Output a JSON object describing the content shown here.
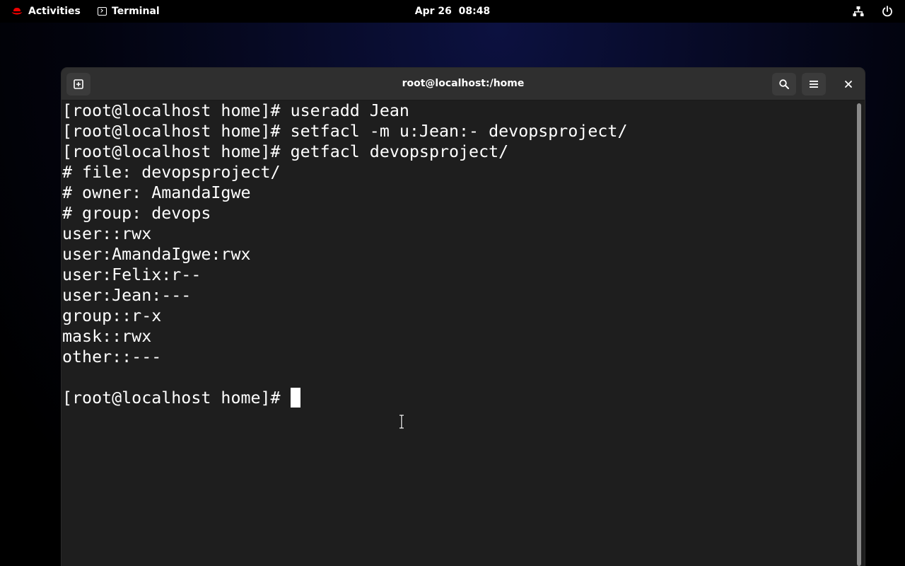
{
  "topbar": {
    "activities_label": "Activities",
    "app_label": "Terminal",
    "clock": "Apr 26  08:48"
  },
  "window": {
    "title": "root@localhost:/home"
  },
  "terminal": {
    "lines": [
      "[root@localhost home]# useradd Jean",
      "[root@localhost home]# setfacl -m u:Jean:- devopsproject/",
      "[root@localhost home]# getfacl devopsproject/",
      "# file: devopsproject/",
      "# owner: AmandaIgwe",
      "# group: devops",
      "user::rwx",
      "user:AmandaIgwe:rwx",
      "user:Felix:r--",
      "user:Jean:---",
      "group::r-x",
      "mask::rwx",
      "other::---",
      "",
      "[root@localhost home]# "
    ]
  },
  "colors": {
    "terminal_bg": "#1e1e1e",
    "headerbar_bg": "#2f2f2f",
    "text": "#ffffff",
    "redhat_red": "#ee0000"
  },
  "icons": {
    "logo": "redhat-logo",
    "app": "terminal-icon",
    "new_tab": "new-tab-icon",
    "search": "search-icon",
    "menu": "hamburger-menu-icon",
    "close": "close-icon",
    "network": "network-icon",
    "power": "power-icon"
  }
}
